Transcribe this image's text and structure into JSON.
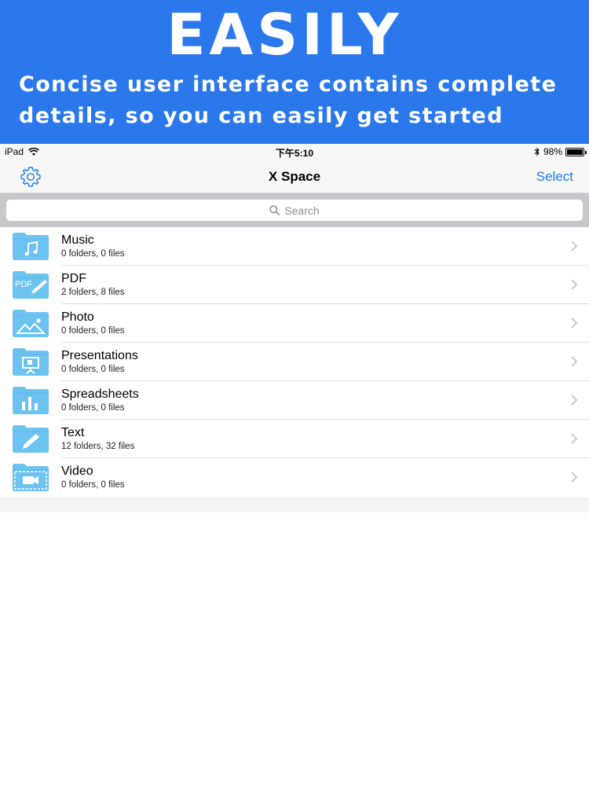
{
  "banner": {
    "title": "EASILY",
    "subtitle_line1": "Concise user interface contains complete",
    "subtitle_line2": "details, so you can easily get started",
    "color": "#2b78ec"
  },
  "status_bar": {
    "device": "iPad",
    "time": "下午5:10",
    "battery": "98%",
    "battery_level": 0.98,
    "icons": [
      "wifi-icon",
      "bluetooth-icon",
      "battery-icon"
    ]
  },
  "nav": {
    "title": "X Space",
    "select_label": "Select",
    "settings_icon": "gear-icon",
    "accent": "#1a7cf5"
  },
  "search": {
    "placeholder": "Search",
    "icon": "search-icon"
  },
  "folders": [
    {
      "name": "Music",
      "meta": "0 folders, 0 files",
      "icon": "music-folder-icon"
    },
    {
      "name": "PDF",
      "meta": "2 folders, 8 files",
      "icon": "pdf-folder-icon"
    },
    {
      "name": "Photo",
      "meta": "0 folders, 0 files",
      "icon": "photo-folder-icon"
    },
    {
      "name": "Presentations",
      "meta": "0 folders, 0 files",
      "icon": "presentation-folder-icon"
    },
    {
      "name": "Spreadsheets",
      "meta": "0 folders, 0 files",
      "icon": "spreadsheet-folder-icon"
    },
    {
      "name": "Text",
      "meta": "12 folders, 32 files",
      "icon": "text-folder-icon"
    },
    {
      "name": "Video",
      "meta": "0 folders, 0 files",
      "icon": "video-folder-icon"
    }
  ],
  "folder_color": "#6cc3f0"
}
